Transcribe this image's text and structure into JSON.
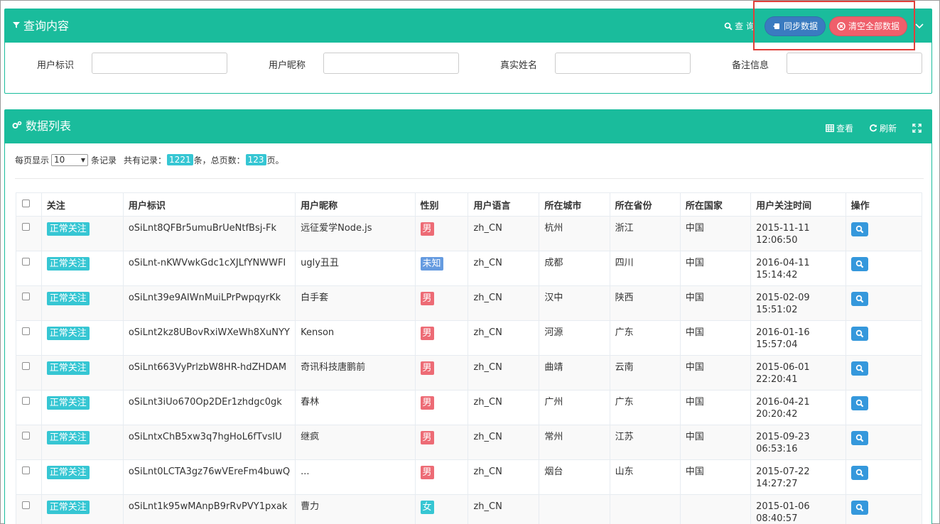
{
  "query": {
    "title": "查询内容",
    "search_label": "查 询",
    "sync_label": "同步数据",
    "clear_label": "清空全部数据",
    "fields": [
      {
        "label": "用户标识",
        "value": ""
      },
      {
        "label": "用户昵称",
        "value": ""
      },
      {
        "label": "真实姓名",
        "value": ""
      },
      {
        "label": "备注信息",
        "value": ""
      }
    ]
  },
  "list": {
    "title": "数据列表",
    "view_label": "查看",
    "refresh_label": "刷新",
    "summary": {
      "per_page_prefix": "每页显示",
      "per_page_value": "10",
      "per_page_suffix": "条记录",
      "total_prefix": "共有记录：",
      "total_records": "1221",
      "total_mid": "条，总页数：",
      "total_pages": "123",
      "total_suffix": "页。"
    },
    "columns": [
      "关注",
      "用户标识",
      "用户昵称",
      "性别",
      "用户语言",
      "所在城市",
      "所在省份",
      "所在国家",
      "用户关注时间",
      "操作"
    ],
    "rows": [
      {
        "follow": "正常关注",
        "openid": "oSiLnt8QFBr5umuBrUeNtfBsj-Fk",
        "nickname": "远征爱学Node.js",
        "sex": "男",
        "lang": "zh_CN",
        "city": "杭州",
        "province": "浙江",
        "country": "中国",
        "date": "2015-11-11",
        "time": "12:06:50"
      },
      {
        "follow": "正常关注",
        "openid": "oSiLnt-nKWVwkGdc1cXJLfYNWWFI",
        "nickname": "ugly丑丑",
        "sex": "未知",
        "lang": "zh_CN",
        "city": "成都",
        "province": "四川",
        "country": "中国",
        "date": "2016-04-11",
        "time": "15:14:42"
      },
      {
        "follow": "正常关注",
        "openid": "oSiLnt39e9AIWnMuiLPrPwpqyrKk",
        "nickname": "白手套",
        "sex": "男",
        "lang": "zh_CN",
        "city": "汉中",
        "province": "陕西",
        "country": "中国",
        "date": "2015-02-09",
        "time": "15:51:02"
      },
      {
        "follow": "正常关注",
        "openid": "oSiLnt2kz8UBovRxiWXeWh8XuNYY",
        "nickname": "Kenson",
        "sex": "男",
        "lang": "zh_CN",
        "city": "河源",
        "province": "广东",
        "country": "中国",
        "date": "2016-01-16",
        "time": "15:57:04"
      },
      {
        "follow": "正常关注",
        "openid": "oSiLnt663VyPrlzbW8HR-hdZHDAM",
        "nickname": "奇讯科技唐鹏前",
        "sex": "男",
        "lang": "zh_CN",
        "city": "曲靖",
        "province": "云南",
        "country": "中国",
        "date": "2015-06-01",
        "time": "22:20:41"
      },
      {
        "follow": "正常关注",
        "openid": "oSiLnt3iUo670Op2DEr1zhdgc0gk",
        "nickname": "春林",
        "sex": "男",
        "lang": "zh_CN",
        "city": "广州",
        "province": "广东",
        "country": "中国",
        "date": "2016-04-21",
        "time": "20:20:42"
      },
      {
        "follow": "正常关注",
        "openid": "oSiLntxChB5xw3q7hgHoL6fTvsIU",
        "nickname": "继疯",
        "sex": "男",
        "lang": "zh_CN",
        "city": "常州",
        "province": "江苏",
        "country": "中国",
        "date": "2015-09-23",
        "time": "06:53:16"
      },
      {
        "follow": "正常关注",
        "openid": "oSiLnt0LCTA3gz76wVEreFm4buwQ",
        "nickname": "...",
        "sex": "男",
        "lang": "zh_CN",
        "city": "烟台",
        "province": "山东",
        "country": "中国",
        "date": "2015-07-22",
        "time": "14:27:27"
      },
      {
        "follow": "正常关注",
        "openid": "oSiLnt1k95wMAnpB9rRvPVY1pxak",
        "nickname": "曹力",
        "sex": "女",
        "lang": "zh_CN",
        "city": "",
        "province": "",
        "country": "",
        "date": "2015-01-06",
        "time": "08:40:57"
      }
    ]
  },
  "colors": {
    "header": "#1abc9c",
    "sync": "#3a7bc0",
    "clear": "#ef5f6b",
    "badge": "#36c6d3",
    "male": "#ed6b75",
    "unknown": "#659be0",
    "female": "#36c6d3",
    "view": "#3598dc"
  }
}
